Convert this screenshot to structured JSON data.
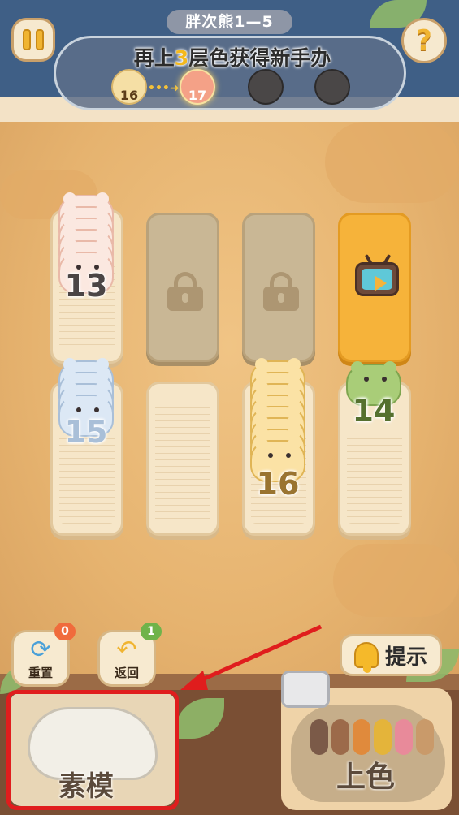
{
  "header": {
    "level": "胖次熊1—5",
    "goal_prefix": "再上",
    "goal_number": "3",
    "goal_suffix": "层色获得新手办",
    "help_label": "?"
  },
  "progress_badges": [
    {
      "value": "16",
      "state": "done"
    },
    {
      "value": "17",
      "state": "current"
    },
    {
      "value": "",
      "state": "locked"
    },
    {
      "value": "",
      "state": "locked"
    }
  ],
  "tubes_top": [
    {
      "type": "stack",
      "color": "pink",
      "count": "13"
    },
    {
      "type": "locked"
    },
    {
      "type": "locked"
    },
    {
      "type": "ad"
    }
  ],
  "tubes_bottom": [
    {
      "type": "stack",
      "color": "blue",
      "count": "15"
    },
    {
      "type": "empty"
    },
    {
      "type": "stack",
      "color": "yellow",
      "count": "16"
    },
    {
      "type": "stack",
      "color": "green",
      "count": "14"
    }
  ],
  "controls": {
    "reset": {
      "label": "重置",
      "count": "0"
    },
    "undo": {
      "label": "返回",
      "count": "1"
    },
    "hint": {
      "label": "提示"
    }
  },
  "cards": {
    "sumo": {
      "label": "素模"
    },
    "color": {
      "label": "上色"
    }
  },
  "colors": {
    "accent": "#f4b91d",
    "highlight": "#e01d1d",
    "reset_badge": "#f06b3c",
    "undo_badge": "#6fb34a"
  }
}
